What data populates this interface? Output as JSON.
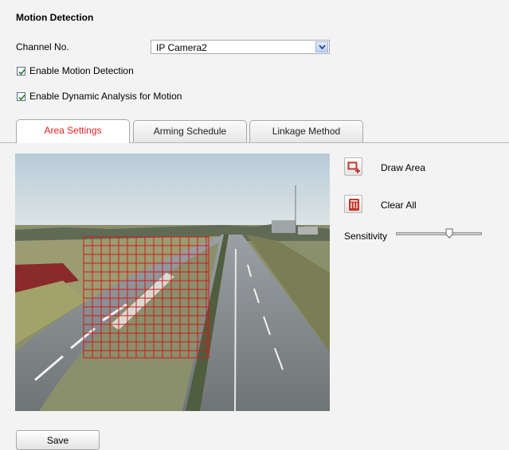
{
  "header": {
    "title": "Motion Detection"
  },
  "channel": {
    "label": "Channel No.",
    "selected": "IP Camera2"
  },
  "checkboxes": {
    "enable_motion": {
      "label": "Enable Motion Detection",
      "checked": true
    },
    "enable_dynamic": {
      "label": "Enable Dynamic Analysis for Motion",
      "checked": true
    }
  },
  "tabs": [
    {
      "label": "Area Settings",
      "active": true
    },
    {
      "label": "Arming Schedule",
      "active": false
    },
    {
      "label": "Linkage Method",
      "active": false
    }
  ],
  "tools": {
    "draw_area": "Draw Area",
    "clear_all": "Clear All",
    "sensitivity_label": "Sensitivity",
    "sensitivity_level": 0.62
  },
  "actions": {
    "save": "Save"
  },
  "colors": {
    "active_tab": "#e22222",
    "grid": "#d11a1a",
    "icon_accent": "#c0392b"
  }
}
